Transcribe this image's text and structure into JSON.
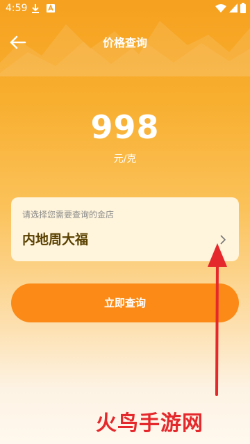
{
  "status_bar": {
    "time": "4:59"
  },
  "header": {
    "title": "价格查询"
  },
  "price": {
    "value": "998",
    "unit": "元/克"
  },
  "store_card": {
    "hint": "请选择您需要查询的金店",
    "store_name": "内地周大福"
  },
  "query_button": {
    "label": "立即查询"
  },
  "watermark": {
    "text": "火鸟手游网"
  },
  "colors": {
    "accent": "#fb8a17",
    "background_top": "#f6a11f",
    "watermark_red": "#e4282b"
  }
}
